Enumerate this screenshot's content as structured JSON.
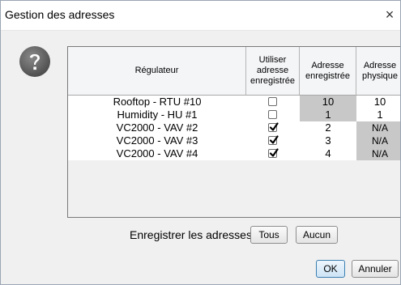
{
  "window": {
    "title": "Gestion des adresses",
    "close_glyph": "×"
  },
  "help_icon": "question-icon",
  "table": {
    "headers": {
      "regulateur": "Régulateur",
      "utiliser": [
        "Utiliser",
        "adresse",
        "enregistrée"
      ],
      "adresse_enregistree": [
        "Adresse",
        "enregistrée"
      ],
      "adresse_physique": [
        "Adresse",
        "physique"
      ]
    },
    "rows": [
      {
        "regulateur": "Rooftop - RTU #10",
        "checked": false,
        "adresse_enregistree": "10",
        "adresse_physique": "10"
      },
      {
        "regulateur": "Humidity - HU #1",
        "checked": false,
        "adresse_enregistree": "1",
        "adresse_physique": "1"
      },
      {
        "regulateur": "VC2000 - VAV #2",
        "checked": true,
        "adresse_enregistree": "2",
        "adresse_physique": "N/A"
      },
      {
        "regulateur": "VC2000 - VAV #3",
        "checked": true,
        "adresse_enregistree": "3",
        "adresse_physique": "N/A"
      },
      {
        "regulateur": "VC2000 - VAV #4",
        "checked": true,
        "adresse_enregistree": "4",
        "adresse_physique": "N/A"
      }
    ],
    "shade_color": "#c8c8c8"
  },
  "bottom": {
    "label": "Enregistrer les adresses:",
    "tous": "Tous",
    "aucun": "Aucun",
    "ok": "OK",
    "annuler": "Annuler"
  }
}
